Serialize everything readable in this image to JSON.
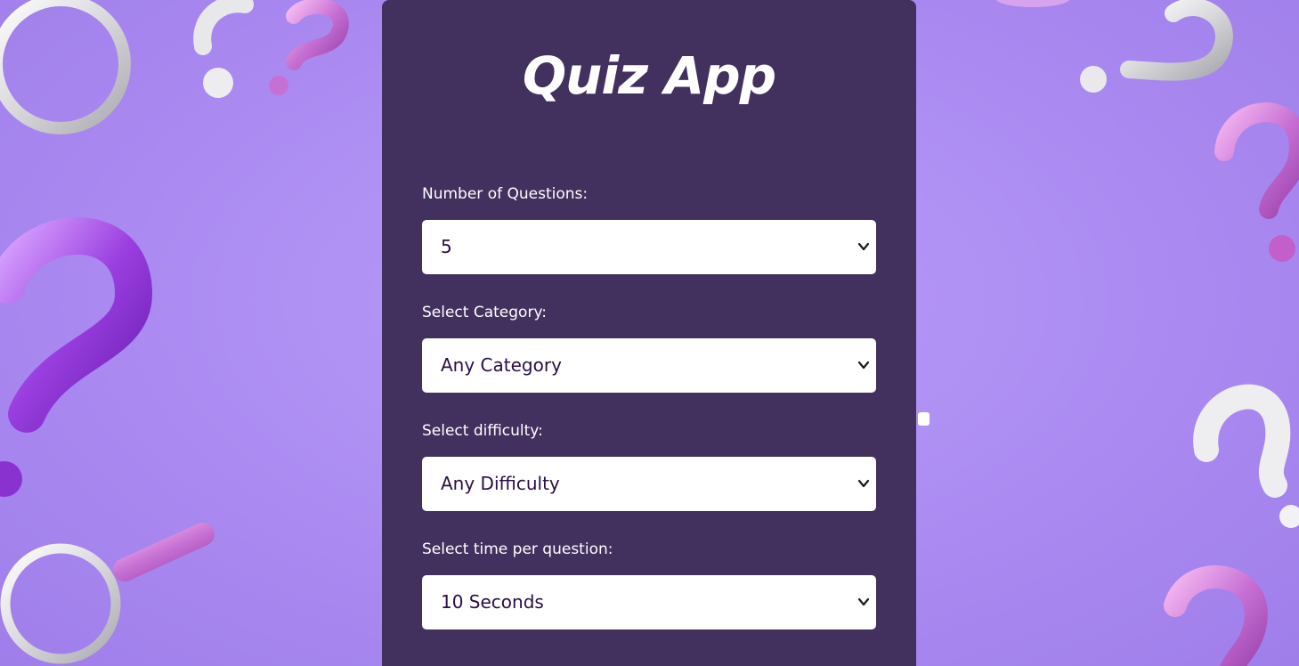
{
  "app": {
    "title": "Quiz App"
  },
  "form": {
    "fields": [
      {
        "label": "Number of Questions:",
        "value": "5"
      },
      {
        "label": "Select Category:",
        "value": "Any Category"
      },
      {
        "label": "Select difficulty:",
        "value": "Any Difficulty"
      },
      {
        "label": "Select time per question:",
        "value": "10 Seconds"
      }
    ]
  },
  "icons": {
    "select_arrow": "chevron-down-icon",
    "decoration": "question-mark-icon"
  },
  "colors": {
    "background": "#ab8bf1",
    "card": "#42305e",
    "select_text": "#2a0d47",
    "label_text": "#ffffff"
  }
}
